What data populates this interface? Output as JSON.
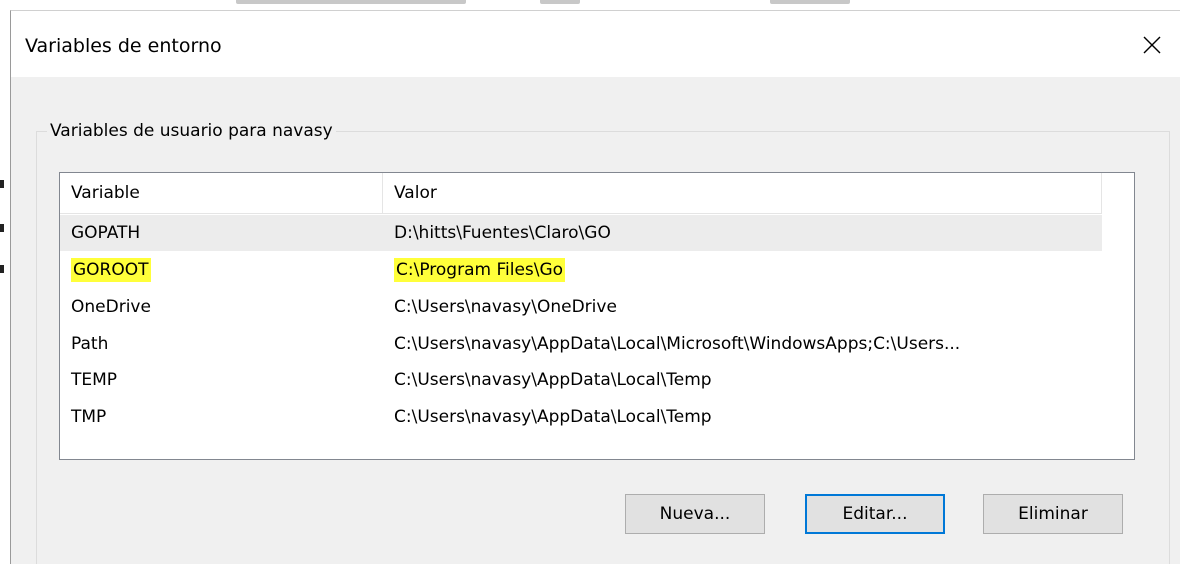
{
  "window": {
    "title": "Variables de entorno"
  },
  "group": {
    "legend": "Variables de usuario para navasy"
  },
  "table": {
    "columns": [
      "Variable",
      "Valor"
    ],
    "rows": [
      {
        "variable": "GOPATH",
        "valor": "D:\\hitts\\Fuentes\\Claro\\GO"
      },
      {
        "variable": "GOROOT",
        "valor": "C:\\Program Files\\Go"
      },
      {
        "variable": "OneDrive",
        "valor": "C:\\Users\\navasy\\OneDrive"
      },
      {
        "variable": "Path",
        "valor": "C:\\Users\\navasy\\AppData\\Local\\Microsoft\\WindowsApps;C:\\Users..."
      },
      {
        "variable": "TEMP",
        "valor": "C:\\Users\\navasy\\AppData\\Local\\Temp"
      },
      {
        "variable": "TMP",
        "valor": "C:\\Users\\navasy\\AppData\\Local\\Temp"
      }
    ]
  },
  "buttons": {
    "new": "Nueva...",
    "edit": "Editar...",
    "delete": "Eliminar"
  },
  "icons": {
    "close": "close-icon"
  },
  "colors": {
    "highlight": "#ffff3a",
    "selected_row": "#ececec",
    "focus_border": "#0078d7"
  }
}
